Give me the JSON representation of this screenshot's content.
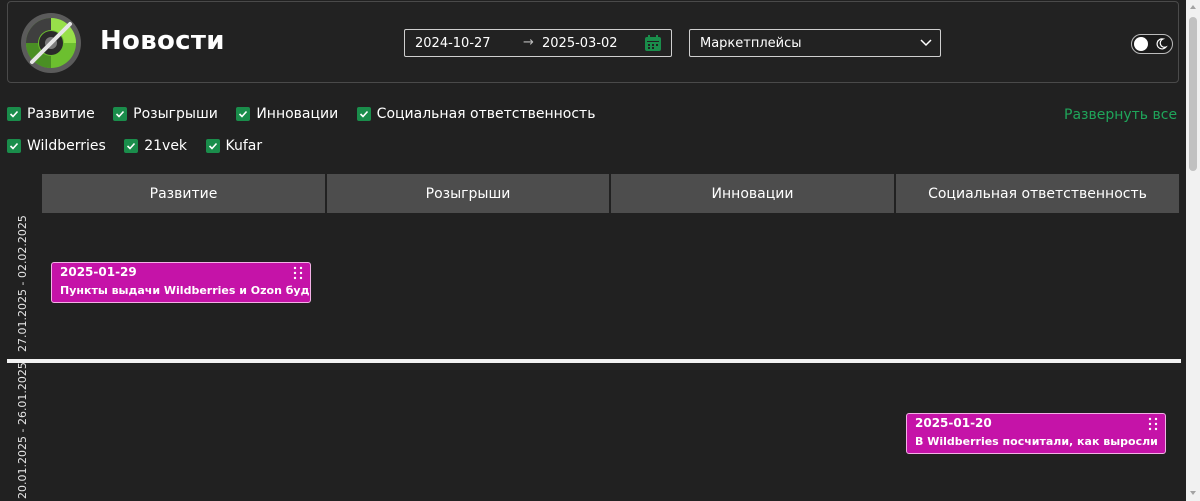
{
  "header": {
    "title": "Новости",
    "date_from": "2024-10-27",
    "date_to": "2025-03-02",
    "marketplace_select": "Маркетплейсы"
  },
  "filters": {
    "categories": [
      "Развитие",
      "Розыгрыши",
      "Инновации",
      "Социальная ответственность"
    ],
    "marketplaces": [
      "Wildberries",
      "21vek",
      "Kufar"
    ],
    "expand_all": "Развернуть все"
  },
  "columns": [
    "Развитие",
    "Розыгрыши",
    "Инновации",
    "Социальная ответственность"
  ],
  "weeks": [
    {
      "label": "27.01.2025 - 02.02.2025",
      "cards": [
        {
          "column": "Развитие",
          "date": "2025-01-29",
          "text": "Пункты выдачи Wildberries и Ozon будут"
        }
      ]
    },
    {
      "label": "20.01.2025 - 26.01.2025",
      "cards": [
        {
          "column": "Социальная ответственность",
          "date": "2025-01-20",
          "text": "В Wildberries посчитали, как выросли"
        }
      ]
    }
  ],
  "colors": {
    "accent_green": "#1a8d4b",
    "card_magenta": "#c513a8",
    "background": "#212121"
  },
  "icons": {
    "logo": "green-disc-logo",
    "calendar": "calendar-icon",
    "select": "chevron-down-icon",
    "theme": "moon-icon",
    "card_menu": "drag-dots-icon"
  }
}
